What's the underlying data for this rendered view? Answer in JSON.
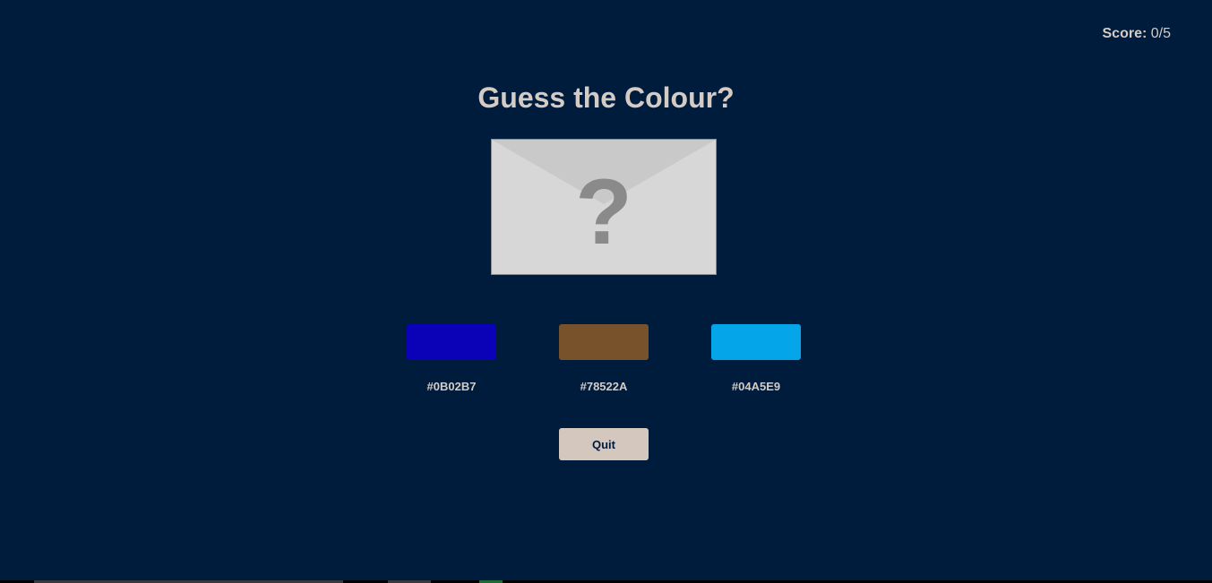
{
  "score": {
    "label": "Score:",
    "value": "0/5"
  },
  "title": "Guess the Colour?",
  "mystery": {
    "icon": "envelope-question-icon",
    "glyph": "?"
  },
  "options": [
    {
      "hex": "#0B02B7",
      "color": "#0b02b7"
    },
    {
      "hex": "#78522A",
      "color": "#78522a"
    },
    {
      "hex": "#04A5E9",
      "color": "#04a5e9"
    }
  ],
  "quit_label": "Quit",
  "colors": {
    "background": "#001c3d",
    "text": "#d4cbc5",
    "quit_button": "#d4c7bd"
  }
}
